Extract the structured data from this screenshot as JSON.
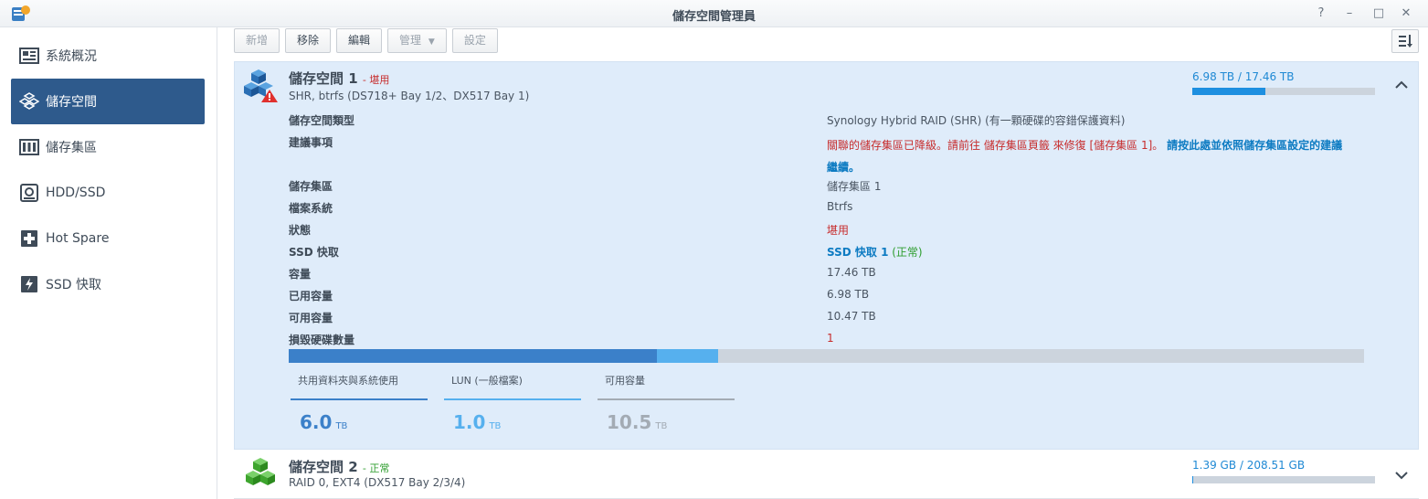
{
  "window": {
    "title": "儲存空間管理員",
    "buttons": {
      "help": "?",
      "minimize": "–",
      "maximize": "□",
      "close": "✕"
    }
  },
  "sidebar": {
    "items": [
      {
        "label": "系統概況",
        "icon": "overview-icon",
        "active": false
      },
      {
        "label": "儲存空間",
        "icon": "volume-icon",
        "active": true
      },
      {
        "label": "儲存集區",
        "icon": "storage-pool-icon",
        "active": false
      },
      {
        "label": "HDD/SSD",
        "icon": "hdd-icon",
        "active": false
      },
      {
        "label": "Hot Spare",
        "icon": "hot-spare-icon",
        "active": false
      },
      {
        "label": "SSD 快取",
        "icon": "ssd-cache-icon",
        "active": false
      }
    ]
  },
  "toolbar": {
    "create": "新增",
    "remove": "移除",
    "edit": "編輯",
    "manage": "管理",
    "settings": "設定"
  },
  "volume1": {
    "name": "儲存空間 1",
    "status": "- 堪用",
    "subtitle": "SHR, btrfs (DS718+ Bay 1/2、DX517 Bay 1)",
    "usage_text": "6.98 TB / 17.46 TB",
    "usage_fraction": 0.4,
    "details": [
      {
        "label": "儲存空間類型",
        "value": "Synology Hybrid RAID (SHR) (有一顆硬碟的容錯保護資料)"
      },
      {
        "label": "建議事項",
        "value": "關聯的儲存集區已降級。請前往 儲存集區頁籤 來修復 [儲存集區 1]。",
        "link": "請按此處並依照儲存集區設定的建議",
        "link2": "繼續。"
      },
      {
        "label": "儲存集區",
        "value": "儲存集區 1"
      },
      {
        "label": "檔案系統",
        "value": "Btrfs"
      },
      {
        "label": "狀態",
        "value": "堪用"
      },
      {
        "label": "SSD 快取",
        "value": "SSD 快取 1",
        "value_suffix": "(正常)"
      },
      {
        "label": "容量",
        "value": "17.46 TB"
      },
      {
        "label": "已用容量",
        "value": "6.98 TB"
      },
      {
        "label": "可用容量",
        "value": "10.47 TB"
      },
      {
        "label": "損毀硬碟數量",
        "value": "1"
      }
    ],
    "breakdown": [
      {
        "label": "共用資料夾與系統使用",
        "value": "6.0",
        "unit": "TB",
        "color": "#3b80c9",
        "fraction": 0.342
      },
      {
        "label": "LUN (一般檔案)",
        "value": "1.0",
        "unit": "TB",
        "color": "#56b0ee",
        "fraction": 0.057
      },
      {
        "label": "可用容量",
        "value": "10.5",
        "unit": "TB",
        "color": "#a3abb4",
        "fraction": 0.601
      }
    ]
  },
  "volume2": {
    "name": "儲存空間 2",
    "status": "- 正常",
    "subtitle": "RAID 0, EXT4 (DX517 Bay 2/3/4)",
    "usage_text": "1.39 GB / 208.51 GB",
    "usage_fraction": 0.007
  },
  "colors": {
    "accent": "#2e5a8c",
    "panel_bg": "#dfecfa",
    "warning": "#c72c2c",
    "ok": "#2e9d2e",
    "link": "#0d7bc2"
  }
}
